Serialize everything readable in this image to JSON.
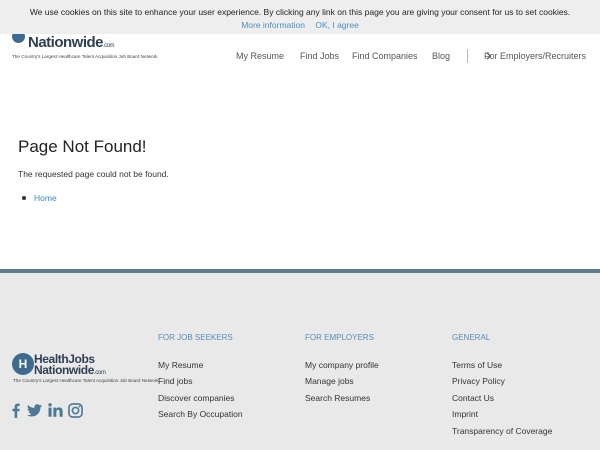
{
  "cookie": {
    "text": "We use cookies on this site to enhance your user experience. By clicking any link on this page you are giving your consent for us to set cookies.",
    "more_info": "More information",
    "agree": "OK, I agree"
  },
  "header": {
    "logo_word": "Nationwide",
    "logo_com": ".com",
    "logo_tagline": "The Country's Largest Healthcare Talent Acquisition Job Board Network",
    "nav": {
      "my_resume": "My Resume",
      "find_jobs": "Find Jobs",
      "find_companies": "Find Companies",
      "blog": "Blog",
      "employers": "For Employers/Recruiters"
    }
  },
  "main": {
    "title": "Page Not Found!",
    "message": "The requested page could not be found.",
    "home_link": "Home"
  },
  "footer": {
    "logo_line1": "HealthJobs",
    "logo_line2": "Nationwide",
    "logo_com": ".com",
    "logo_tagline": "The Country's Largest Healthcare Talent Acquisition Job Board Network",
    "columns": [
      {
        "heading": "FOR JOB SEEKERS",
        "items": [
          "My Resume",
          "Find jobs",
          "Discover companies",
          "Search By Occupation"
        ]
      },
      {
        "heading": "FOR EMPLOYERS",
        "items": [
          "My company profile",
          "Manage jobs",
          "Search Resumes"
        ]
      },
      {
        "heading": "GENERAL",
        "items": [
          "Terms of Use",
          "Privacy Policy",
          "Contact Us",
          "Imprint",
          "Transparency of Coverage"
        ]
      }
    ],
    "social_icons": [
      "facebook-icon",
      "twitter-icon",
      "linkedin-icon",
      "instagram-icon"
    ]
  },
  "colors": {
    "accent_blue": "#4a8ec4",
    "footer_heading": "#5a8bb5",
    "footer_bg": "#e9e9e9",
    "footer_bar": "#5d7d8e",
    "logo_navy": "#2e3f54"
  }
}
